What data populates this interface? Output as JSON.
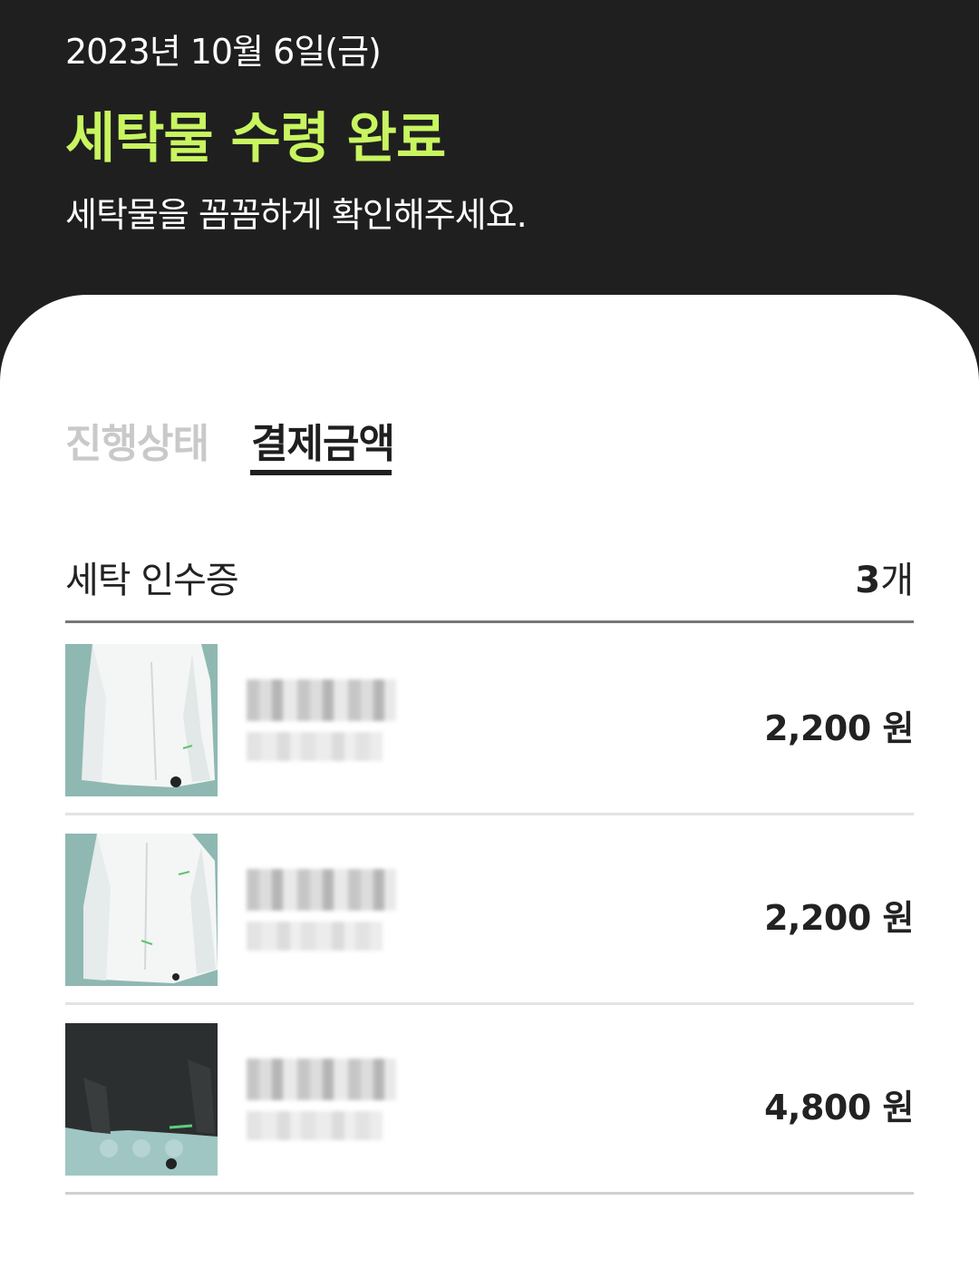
{
  "header": {
    "date": "2023년 10월 6일(금)",
    "title": "세탁물 수령 완료",
    "subtitle": "세탁물을 꼼꼼하게 확인해주세요.",
    "accent_color": "#c8f560"
  },
  "tabs": [
    {
      "label": "진행상태",
      "active": false
    },
    {
      "label": "결제금액",
      "active": true
    }
  ],
  "receipt": {
    "title": "세탁 인수증",
    "count_number": "3",
    "count_unit": "개",
    "items": [
      {
        "image": "white-shirt-photo",
        "name": "",
        "detail": "",
        "price": "2,200 원"
      },
      {
        "image": "white-shirt-photo",
        "name": "",
        "detail": "",
        "price": "2,200 원"
      },
      {
        "image": "black-shirt-photo",
        "name": "",
        "detail": "",
        "price": "4,800 원"
      }
    ]
  }
}
